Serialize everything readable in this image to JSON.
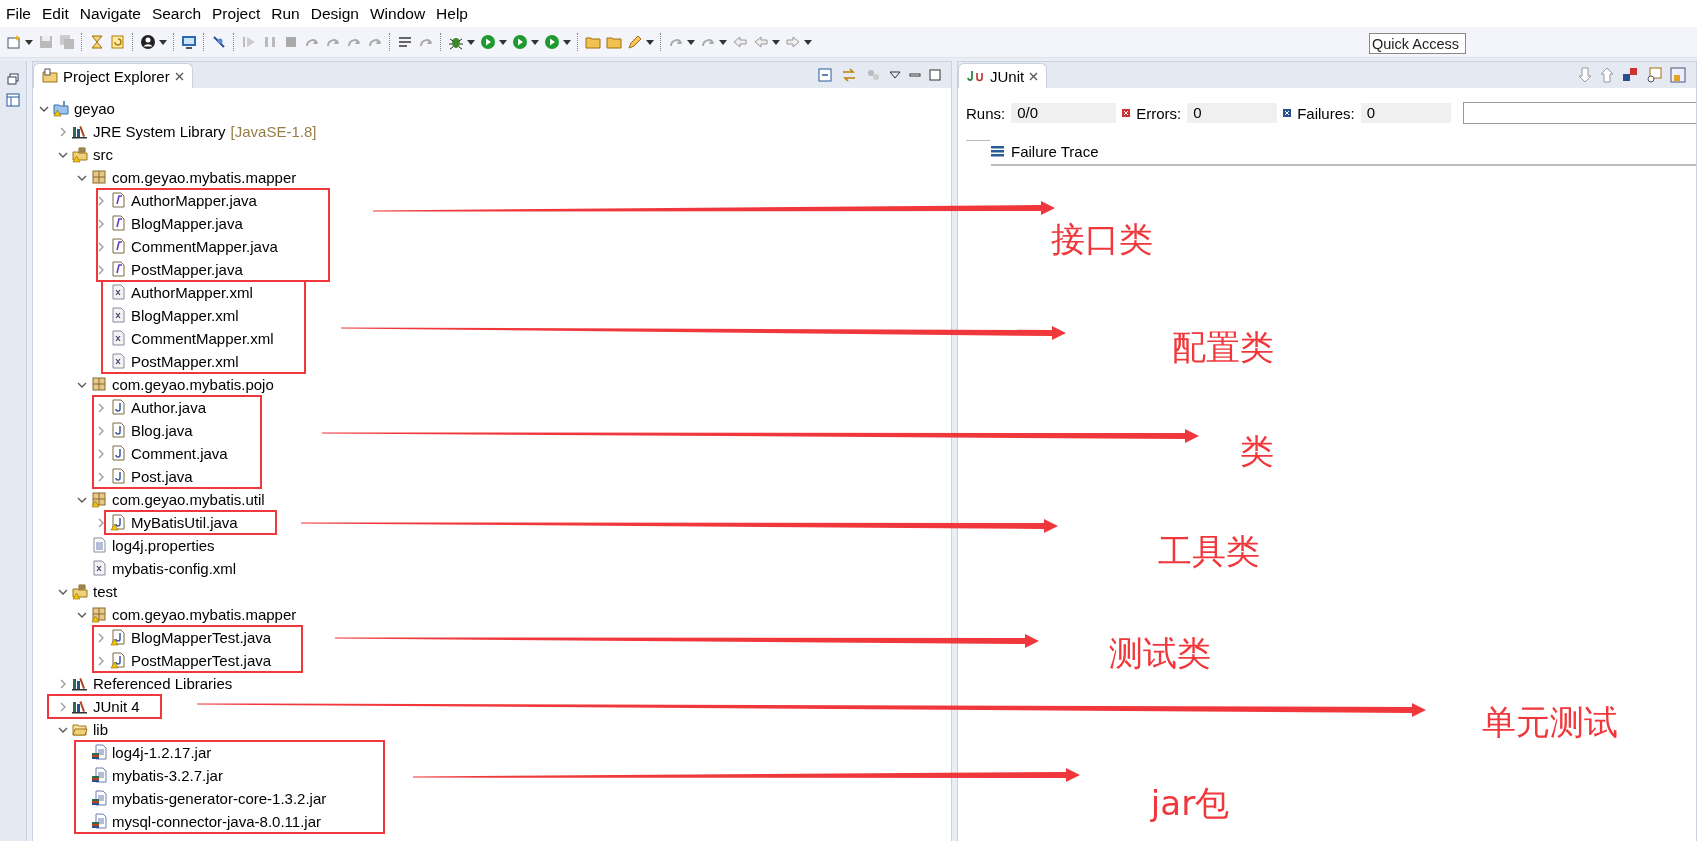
{
  "menu": [
    "File",
    "Edit",
    "Navigate",
    "Search",
    "Project",
    "Run",
    "Design",
    "Window",
    "Help"
  ],
  "quick_access": {
    "placeholder": "Quick Access"
  },
  "project_explorer": {
    "title": "Project Explorer",
    "tree": [
      {
        "label": "geyao",
        "kind": "project",
        "warning": true,
        "expanded": true,
        "children": [
          {
            "label": "JRE System Library",
            "decoration": "[JavaSE-1.8]",
            "kind": "library",
            "expanded": false
          },
          {
            "label": "src",
            "kind": "source-folder",
            "warning": true,
            "expanded": true,
            "children": [
              {
                "label": "com.geyao.mybatis.mapper",
                "kind": "package",
                "expanded": true,
                "children": [
                  {
                    "label": "AuthorMapper.java",
                    "kind": "interface",
                    "expanded": false
                  },
                  {
                    "label": "BlogMapper.java",
                    "kind": "interface",
                    "expanded": false
                  },
                  {
                    "label": "CommentMapper.java",
                    "kind": "interface",
                    "expanded": false
                  },
                  {
                    "label": "PostMapper.java",
                    "kind": "interface",
                    "expanded": false
                  },
                  {
                    "label": "AuthorMapper.xml",
                    "kind": "xml"
                  },
                  {
                    "label": "BlogMapper.xml",
                    "kind": "xml"
                  },
                  {
                    "label": "CommentMapper.xml",
                    "kind": "xml"
                  },
                  {
                    "label": "PostMapper.xml",
                    "kind": "xml"
                  }
                ]
              },
              {
                "label": "com.geyao.mybatis.pojo",
                "kind": "package",
                "expanded": true,
                "children": [
                  {
                    "label": "Author.java",
                    "kind": "class",
                    "expanded": false
                  },
                  {
                    "label": "Blog.java",
                    "kind": "class",
                    "expanded": false
                  },
                  {
                    "label": "Comment.java",
                    "kind": "class",
                    "expanded": false
                  },
                  {
                    "label": "Post.java",
                    "kind": "class",
                    "expanded": false
                  }
                ]
              },
              {
                "label": "com.geyao.mybatis.util",
                "kind": "package",
                "warning": true,
                "expanded": true,
                "children": [
                  {
                    "label": "MyBatisUtil.java",
                    "kind": "class",
                    "warning": true,
                    "expanded": false
                  }
                ]
              },
              {
                "label": "log4j.properties",
                "kind": "properties"
              },
              {
                "label": "mybatis-config.xml",
                "kind": "xml"
              }
            ]
          },
          {
            "label": "test",
            "kind": "source-folder",
            "warning": true,
            "expanded": true,
            "children": [
              {
                "label": "com.geyao.mybatis.mapper",
                "kind": "package",
                "warning": true,
                "expanded": true,
                "children": [
                  {
                    "label": "BlogMapperTest.java",
                    "kind": "class",
                    "warning": true,
                    "expanded": false
                  },
                  {
                    "label": "PostMapperTest.java",
                    "kind": "class",
                    "warning": true,
                    "expanded": false
                  }
                ]
              }
            ]
          },
          {
            "label": "Referenced Libraries",
            "kind": "library",
            "expanded": false
          },
          {
            "label": "JUnit 4",
            "kind": "library",
            "expanded": false
          },
          {
            "label": "lib",
            "kind": "folder",
            "expanded": true,
            "children": [
              {
                "label": "log4j-1.2.17.jar",
                "kind": "jar"
              },
              {
                "label": "mybatis-3.2.7.jar",
                "kind": "jar"
              },
              {
                "label": "mybatis-generator-core-1.3.2.jar",
                "kind": "jar"
              },
              {
                "label": "mysql-connector-java-8.0.11.jar",
                "kind": "jar"
              }
            ]
          }
        ]
      }
    ]
  },
  "junit": {
    "title": "JUnit",
    "runs_label": "Runs:",
    "runs": "0/0",
    "errors_label": "Errors:",
    "errors": "0",
    "failures_label": "Failures:",
    "failures": "0",
    "failure_trace": "Failure Trace",
    "progress": {
      "level": 0
    }
  },
  "annotations": [
    {
      "label": "接口类"
    },
    {
      "label": "配置类"
    },
    {
      "label": "类"
    },
    {
      "label": "工具类"
    },
    {
      "label": "测试类"
    },
    {
      "label": "单元测试"
    },
    {
      "label": "jar包"
    }
  ]
}
